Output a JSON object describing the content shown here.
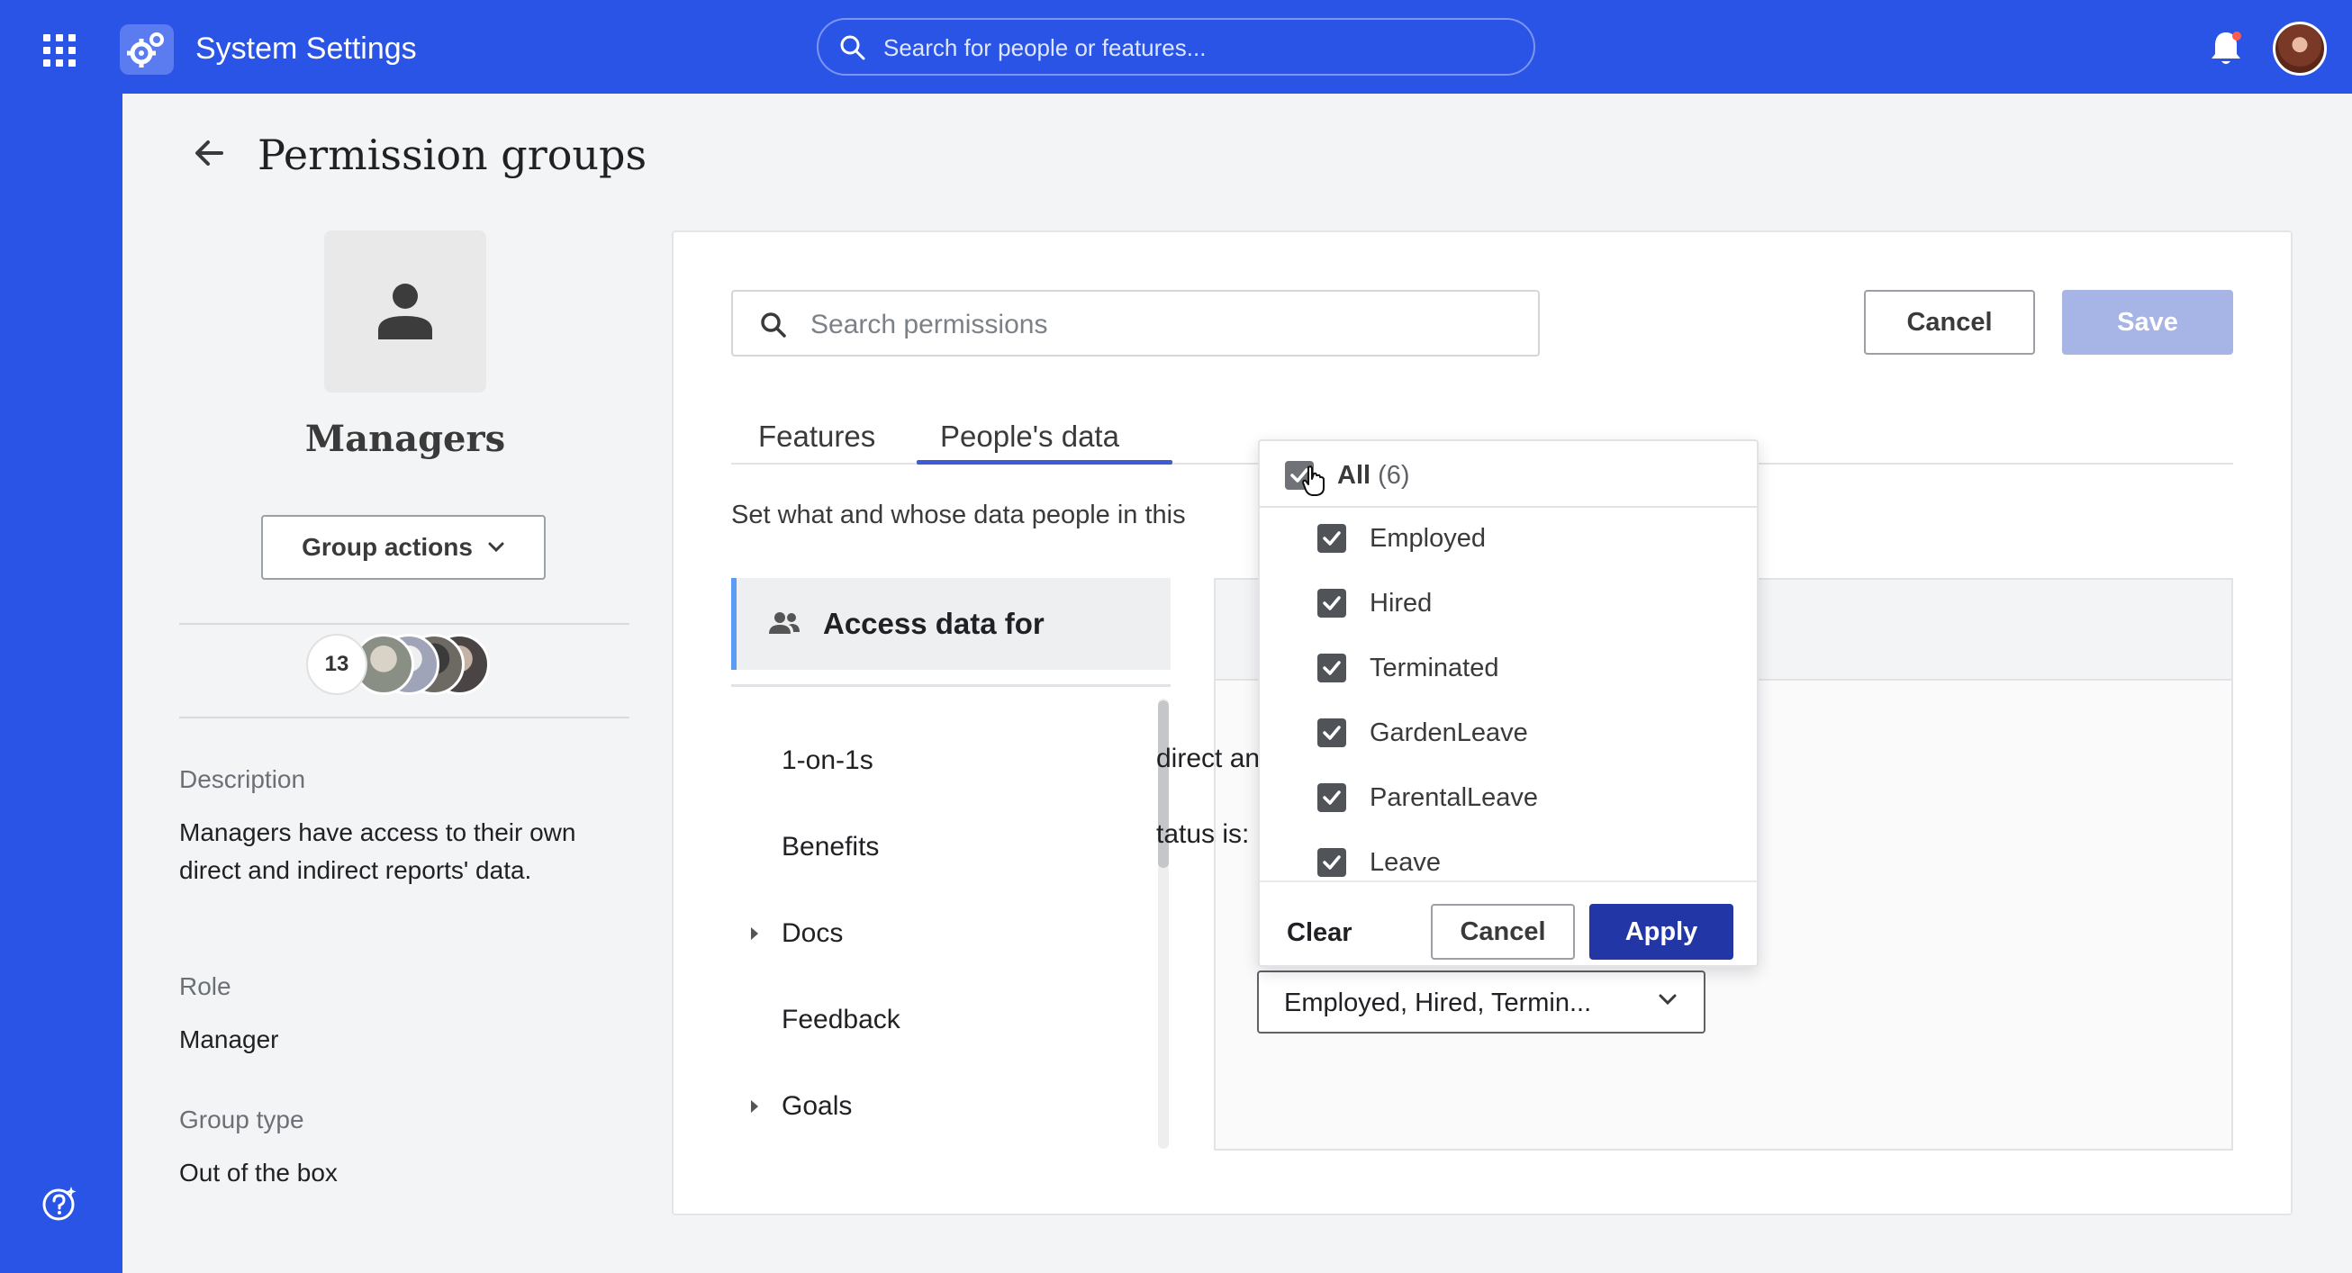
{
  "topbar": {
    "app_title": "System Settings",
    "search_placeholder": "Search for people or features..."
  },
  "page": {
    "title": "Permission groups"
  },
  "group": {
    "name": "Managers",
    "actions_label": "Group actions",
    "member_count": "13",
    "description_label": "Description",
    "description": "Managers have access to their own direct and indirect reports' data.",
    "role_label": "Role",
    "role": "Manager",
    "type_label": "Group type",
    "type": "Out of the box"
  },
  "editor": {
    "search_placeholder": "Search permissions",
    "cancel_label": "Cancel",
    "save_label": "Save",
    "tabs": [
      {
        "label": "Features",
        "active": false
      },
      {
        "label": "People's data",
        "active": true
      }
    ],
    "intro": "Set what and whose data people in this",
    "access_heading": "Access data for",
    "nav_items": [
      {
        "label": "1-on-1s",
        "expandable": false
      },
      {
        "label": "Benefits",
        "expandable": false
      },
      {
        "label": "Docs",
        "expandable": true
      },
      {
        "label": "Feedback",
        "expandable": false
      },
      {
        "label": "Goals",
        "expandable": true
      }
    ],
    "detail_line1": "direct and indirect reports'",
    "detail_line2": "tatus is:",
    "status_select_value": "Employed, Hired, Termin..."
  },
  "status_dropdown": {
    "all_label": "All",
    "all_count": "(6)",
    "options": [
      {
        "label": "Employed",
        "checked": true
      },
      {
        "label": "Hired",
        "checked": true
      },
      {
        "label": "Terminated",
        "checked": true
      },
      {
        "label": "GardenLeave",
        "checked": true
      },
      {
        "label": "ParentalLeave",
        "checked": true
      },
      {
        "label": "Leave",
        "checked": true
      }
    ],
    "clear_label": "Clear",
    "cancel_label": "Cancel",
    "apply_label": "Apply"
  },
  "colors": {
    "brand_blue": "#2a54e6",
    "apply_button": "#2236a6",
    "save_disabled": "#a7b4e6",
    "tab_active": "#3d5bd6",
    "access_accent": "#5c9cf4"
  }
}
